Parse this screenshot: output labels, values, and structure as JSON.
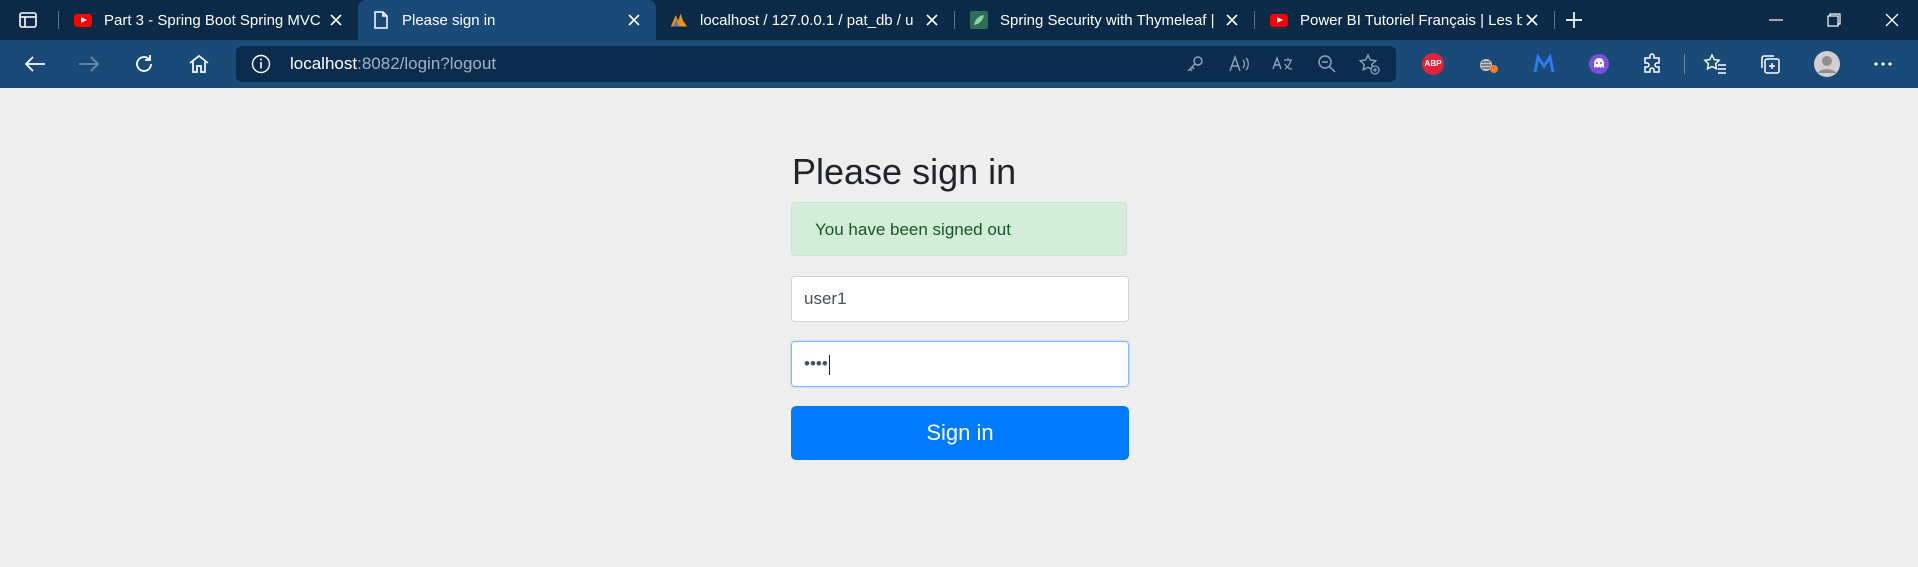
{
  "browser": {
    "tabs": [
      {
        "title": "Part 3 - Spring Boot Spring MVC",
        "icon": "youtube-icon",
        "active": false
      },
      {
        "title": "Please sign in",
        "icon": "document-icon",
        "active": true
      },
      {
        "title": "localhost / 127.0.0.1 / pat_db / u",
        "icon": "phpmyadmin-icon",
        "active": false
      },
      {
        "title": "Spring Security with Thymeleaf |",
        "icon": "leaf-icon",
        "active": false
      },
      {
        "title": "Power BI Tutoriel Français | Les b",
        "icon": "youtube-icon",
        "active": false
      }
    ],
    "address": {
      "host": "localhost",
      "rest": ":8082/login?logout"
    },
    "extensions": {
      "abp": "ABP"
    },
    "accent_color": "#1a4a78"
  },
  "page": {
    "title": "Please sign in",
    "alert": "You have been signed out",
    "username_value": "user1",
    "password_mask": "••••",
    "submit_label": "Sign in",
    "colors": {
      "button": "#007bff",
      "alert_bg": "#d4edda",
      "alert_text": "#155724"
    }
  }
}
